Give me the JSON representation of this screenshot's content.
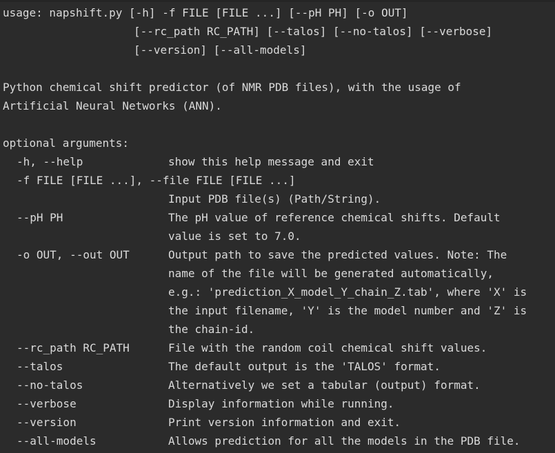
{
  "usage": {
    "line1": "usage: napshift.py [-h] -f FILE [FILE ...] [--pH PH] [-o OUT]",
    "line2": "[--rc_path RC_PATH] [--talos] [--no-talos] [--verbose]",
    "line3": "[--version] [--all-models]"
  },
  "description": {
    "line1": "Python chemical shift predictor (of NMR PDB files), with the usage of",
    "line2": "Artificial Neural Networks (ANN)."
  },
  "section_header": "optional arguments:",
  "rows": [
    {
      "name": "-h, --help",
      "desc": "show this help message and exit"
    },
    {
      "name": "-f FILE [FILE ...], --file FILE [FILE ...]",
      "desc": ""
    },
    {
      "name": "",
      "desc": "Input PDB file(s) (Path/String)."
    },
    {
      "name": "--pH PH",
      "desc": "The pH value of reference chemical shifts. Default"
    },
    {
      "name": "",
      "desc": "value is set to 7.0."
    },
    {
      "name": "-o OUT, --out OUT",
      "desc": "Output path to save the predicted values. Note: The"
    },
    {
      "name": "",
      "desc": "name of the file will be generated automatically,"
    },
    {
      "name": "",
      "desc": "e.g.: 'prediction_X_model_Y_chain_Z.tab', where 'X' is"
    },
    {
      "name": "",
      "desc": "the input filename, 'Y' is the model number and 'Z' is"
    },
    {
      "name": "",
      "desc": "the chain-id."
    },
    {
      "name": "--rc_path RC_PATH",
      "desc": "File with the random coil chemical shift values."
    },
    {
      "name": "--talos",
      "desc": "The default output is the 'TALOS' format."
    },
    {
      "name": "--no-talos",
      "desc": "Alternatively we set a tabular (output) format."
    },
    {
      "name": "--verbose",
      "desc": "Display information while running."
    },
    {
      "name": "--version",
      "desc": "Print version information and exit."
    },
    {
      "name": "--all-models",
      "desc": "Allows prediction for all the models in the PDB file."
    }
  ]
}
